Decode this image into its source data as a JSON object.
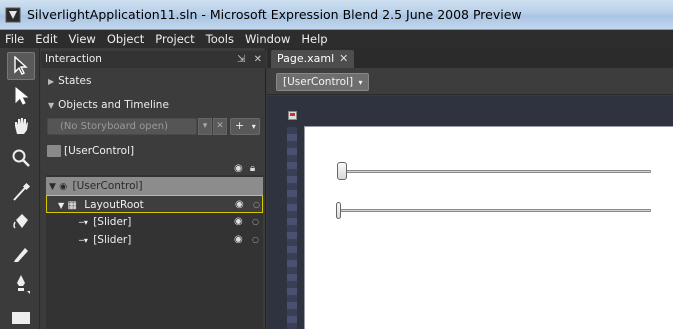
{
  "window": {
    "title": "SilverlightApplication11.sln - Microsoft Expression Blend 2.5 June 2008 Preview"
  },
  "menu": {
    "items": [
      "File",
      "Edit",
      "View",
      "Object",
      "Project",
      "Tools",
      "Window",
      "Help"
    ]
  },
  "tools": {
    "icons": [
      "selection-arrow-icon",
      "direct-selection-icon",
      "pan-hand-icon",
      "zoom-icon",
      "eyedropper-icon",
      "paint-bucket-icon",
      "pencil-icon",
      "pen-icon",
      "rectangle-icon"
    ],
    "active_index": 0
  },
  "interaction": {
    "title": "Interaction",
    "states_label": "States",
    "objects_label": "Objects and Timeline",
    "storyboard_placeholder": "(No Storyboard open)",
    "add_label": "+",
    "scope_label": "[UserControl]",
    "tree": {
      "root": "[UserControl]",
      "layout_root": "LayoutRoot",
      "children": [
        "[Slider]",
        "[Slider]"
      ]
    }
  },
  "document": {
    "tab_label": "Page.xaml",
    "breadcrumb": "[UserControl]",
    "sliders": [
      {
        "value": 0,
        "orientation": "horizontal"
      },
      {
        "value": 0,
        "orientation": "horizontal"
      }
    ]
  },
  "colors": {
    "selection_border": "#d8c800",
    "title_bar": "#b7cfe8",
    "panel_bg": "#3c3c3c"
  }
}
